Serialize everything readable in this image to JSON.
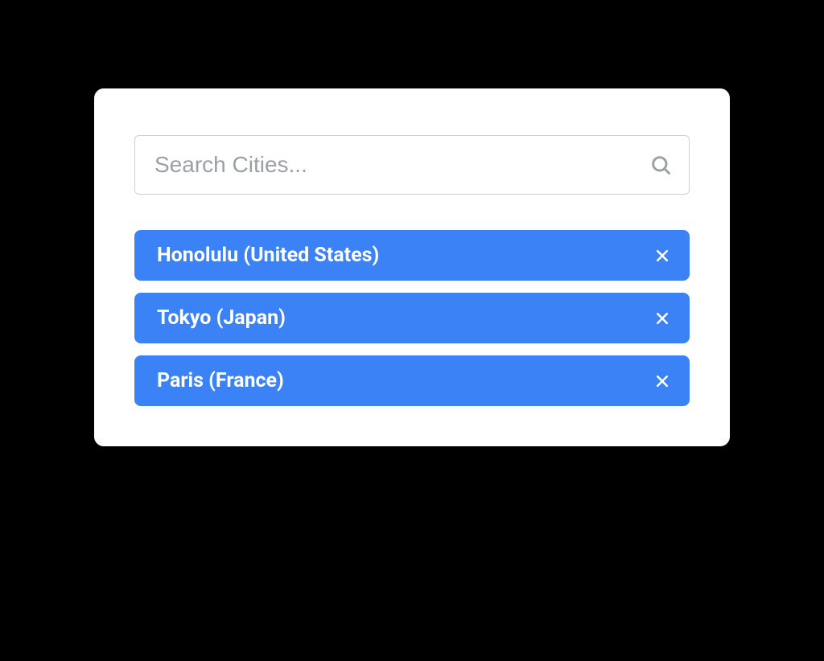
{
  "search": {
    "placeholder": "Search Cities...",
    "value": ""
  },
  "chips": [
    {
      "label": "Honolulu (United States)"
    },
    {
      "label": "Tokyo (Japan)"
    },
    {
      "label": "Paris (France)"
    }
  ],
  "colors": {
    "chip_bg": "#3b82f6",
    "chip_text": "#ffffff",
    "card_bg": "#ffffff",
    "page_bg": "#000000"
  }
}
